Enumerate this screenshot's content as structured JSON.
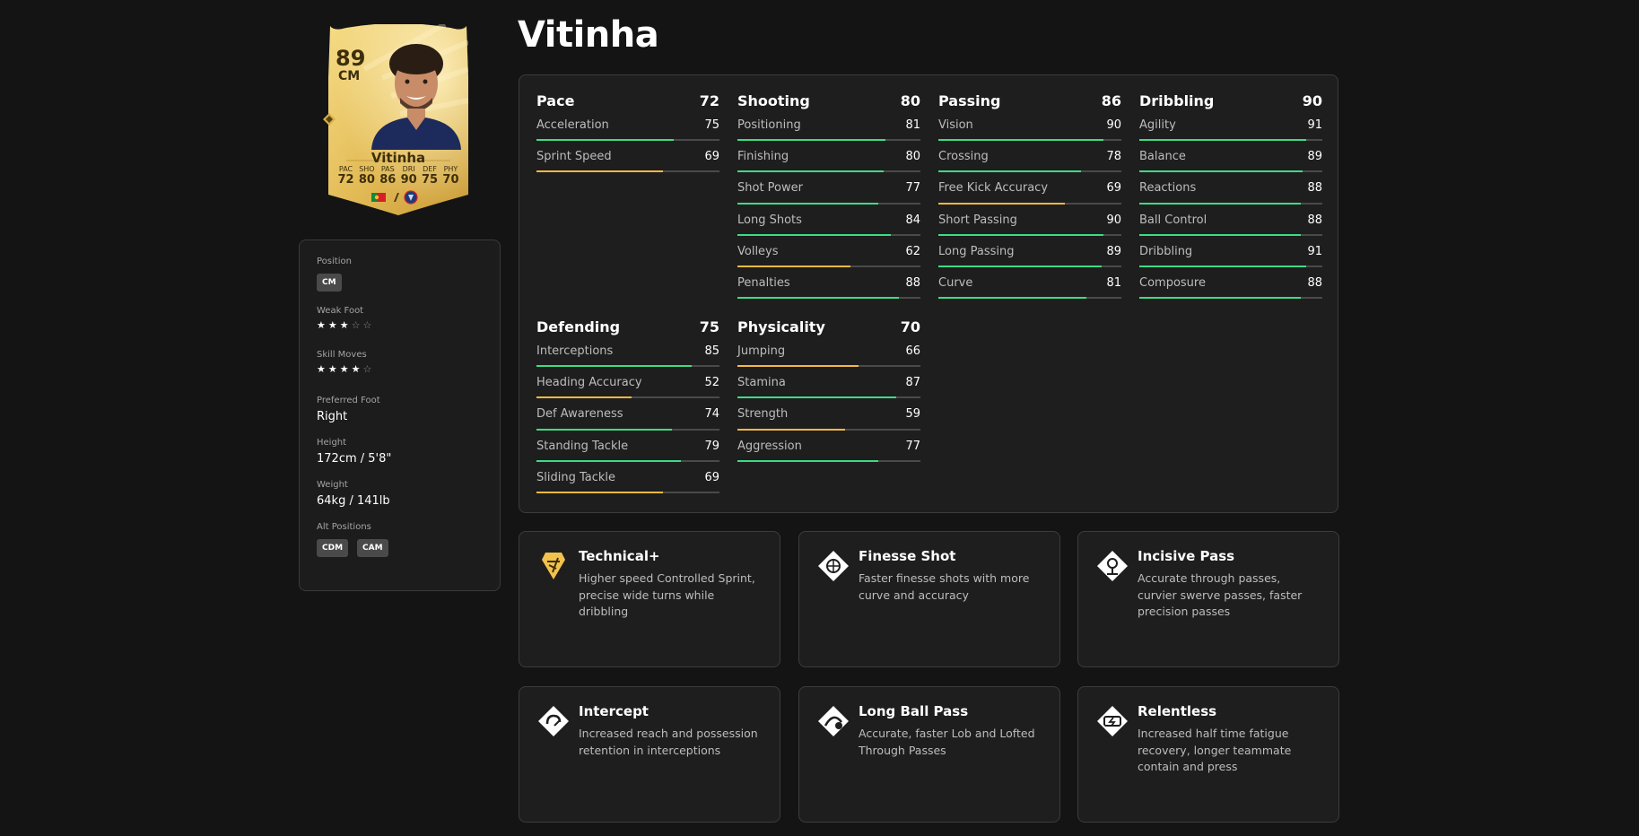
{
  "player": {
    "name": "Vitinha",
    "rating": "89",
    "position": "CM",
    "card_name": "Vitinha",
    "card_attributes": [
      {
        "label": "PAC",
        "value": "72"
      },
      {
        "label": "SHO",
        "value": "80"
      },
      {
        "label": "PAS",
        "value": "86"
      },
      {
        "label": "DRI",
        "value": "90"
      },
      {
        "label": "DEF",
        "value": "75"
      },
      {
        "label": "PHY",
        "value": "70"
      }
    ]
  },
  "info": {
    "position_label": "Position",
    "position_value": "CM",
    "weak_foot_label": "Weak Foot",
    "weak_foot_stars": 3,
    "skill_moves_label": "Skill Moves",
    "skill_moves_stars": 4,
    "preferred_foot_label": "Preferred Foot",
    "preferred_foot_value": "Right",
    "height_label": "Height",
    "height_value": "172cm / 5'8\"",
    "weight_label": "Weight",
    "weight_value": "64kg / 141lb",
    "alt_positions_label": "Alt Positions",
    "alt_positions": [
      "CDM",
      "CAM"
    ]
  },
  "stats": [
    {
      "name": "Pace",
      "value": "72",
      "subs": [
        {
          "name": "Acceleration",
          "value": 75
        },
        {
          "name": "Sprint Speed",
          "value": 69
        }
      ]
    },
    {
      "name": "Shooting",
      "value": "80",
      "subs": [
        {
          "name": "Positioning",
          "value": 81
        },
        {
          "name": "Finishing",
          "value": 80
        },
        {
          "name": "Shot Power",
          "value": 77
        },
        {
          "name": "Long Shots",
          "value": 84
        },
        {
          "name": "Volleys",
          "value": 62
        },
        {
          "name": "Penalties",
          "value": 88
        }
      ]
    },
    {
      "name": "Passing",
      "value": "86",
      "subs": [
        {
          "name": "Vision",
          "value": 90
        },
        {
          "name": "Crossing",
          "value": 78
        },
        {
          "name": "Free Kick Accuracy",
          "value": 69
        },
        {
          "name": "Short Passing",
          "value": 90
        },
        {
          "name": "Long Passing",
          "value": 89
        },
        {
          "name": "Curve",
          "value": 81
        }
      ]
    },
    {
      "name": "Dribbling",
      "value": "90",
      "subs": [
        {
          "name": "Agility",
          "value": 91
        },
        {
          "name": "Balance",
          "value": 89
        },
        {
          "name": "Reactions",
          "value": 88
        },
        {
          "name": "Ball Control",
          "value": 88
        },
        {
          "name": "Dribbling",
          "value": 91
        },
        {
          "name": "Composure",
          "value": 88
        }
      ]
    },
    {
      "name": "Defending",
      "value": "75",
      "subs": [
        {
          "name": "Interceptions",
          "value": 85
        },
        {
          "name": "Heading Accuracy",
          "value": 52
        },
        {
          "name": "Def Awareness",
          "value": 74
        },
        {
          "name": "Standing Tackle",
          "value": 79
        },
        {
          "name": "Sliding Tackle",
          "value": 69
        }
      ]
    },
    {
      "name": "Physicality",
      "value": "70",
      "subs": [
        {
          "name": "Jumping",
          "value": 66
        },
        {
          "name": "Stamina",
          "value": 87
        },
        {
          "name": "Strength",
          "value": 59
        },
        {
          "name": "Aggression",
          "value": 77
        }
      ]
    }
  ],
  "colors": {
    "high_stat": "#3ddc84",
    "mid_stat": "#f4b942",
    "card_gold": "#e6c15c"
  },
  "playstyles": [
    {
      "title": "Technical+",
      "description": "Higher speed Controlled Sprint, precise wide turns while dribbling",
      "icon": "technical-plus-icon",
      "plus": true
    },
    {
      "title": "Finesse Shot",
      "description": "Faster finesse shots with more curve and accuracy",
      "icon": "finesse-shot-icon",
      "plus": false
    },
    {
      "title": "Incisive Pass",
      "description": "Accurate through passes, curvier swerve passes, faster precision passes",
      "icon": "incisive-pass-icon",
      "plus": false
    },
    {
      "title": "Intercept",
      "description": "Increased reach and possession retention in interceptions",
      "icon": "intercept-icon",
      "plus": false
    },
    {
      "title": "Long Ball Pass",
      "description": "Accurate, faster Lob and Lofted Through Passes",
      "icon": "long-ball-pass-icon",
      "plus": false
    },
    {
      "title": "Relentless",
      "description": "Increased half time fatigue recovery, longer teammate contain and press",
      "icon": "relentless-icon",
      "plus": false
    }
  ]
}
